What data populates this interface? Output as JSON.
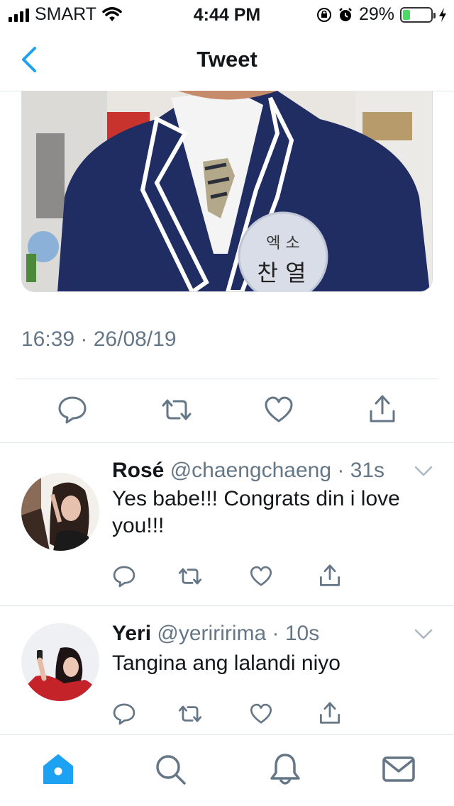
{
  "status_bar": {
    "carrier": "SMART",
    "time": "4:44 PM",
    "battery_percent": "29%",
    "battery_level": 0.29,
    "icons": [
      "signal-icon",
      "wifi-icon",
      "orientation-lock-icon",
      "alarm-icon",
      "battery-icon",
      "charging-icon"
    ]
  },
  "nav": {
    "title": "Tweet",
    "back_icon": "chevron-left-icon"
  },
  "tweet": {
    "media_text_top": "엑 소",
    "media_text_bottom": "찬 열",
    "timestamp": "16:39 · 26/08/19",
    "actions": [
      "reply-icon",
      "retweet-icon",
      "like-icon",
      "share-icon"
    ]
  },
  "replies": [
    {
      "name": "Rosé",
      "handle": "@chaengchaeng",
      "sep": " · ",
      "time": "31s",
      "text": "Yes babe!!! Congrats din i love you!!!"
    },
    {
      "name": "Yeri",
      "handle": "@yeriririma",
      "sep": " · ",
      "time": "10s",
      "text": "Tangina ang lalandi niyo"
    }
  ],
  "colors": {
    "accent": "#1da1f2",
    "secondary_text": "#657786",
    "icon_gray": "#657786",
    "divider": "#e1e8ed",
    "battery_green": "#4cd964"
  },
  "tab_bar": [
    "home-icon",
    "search-icon",
    "notifications-icon",
    "messages-icon"
  ]
}
